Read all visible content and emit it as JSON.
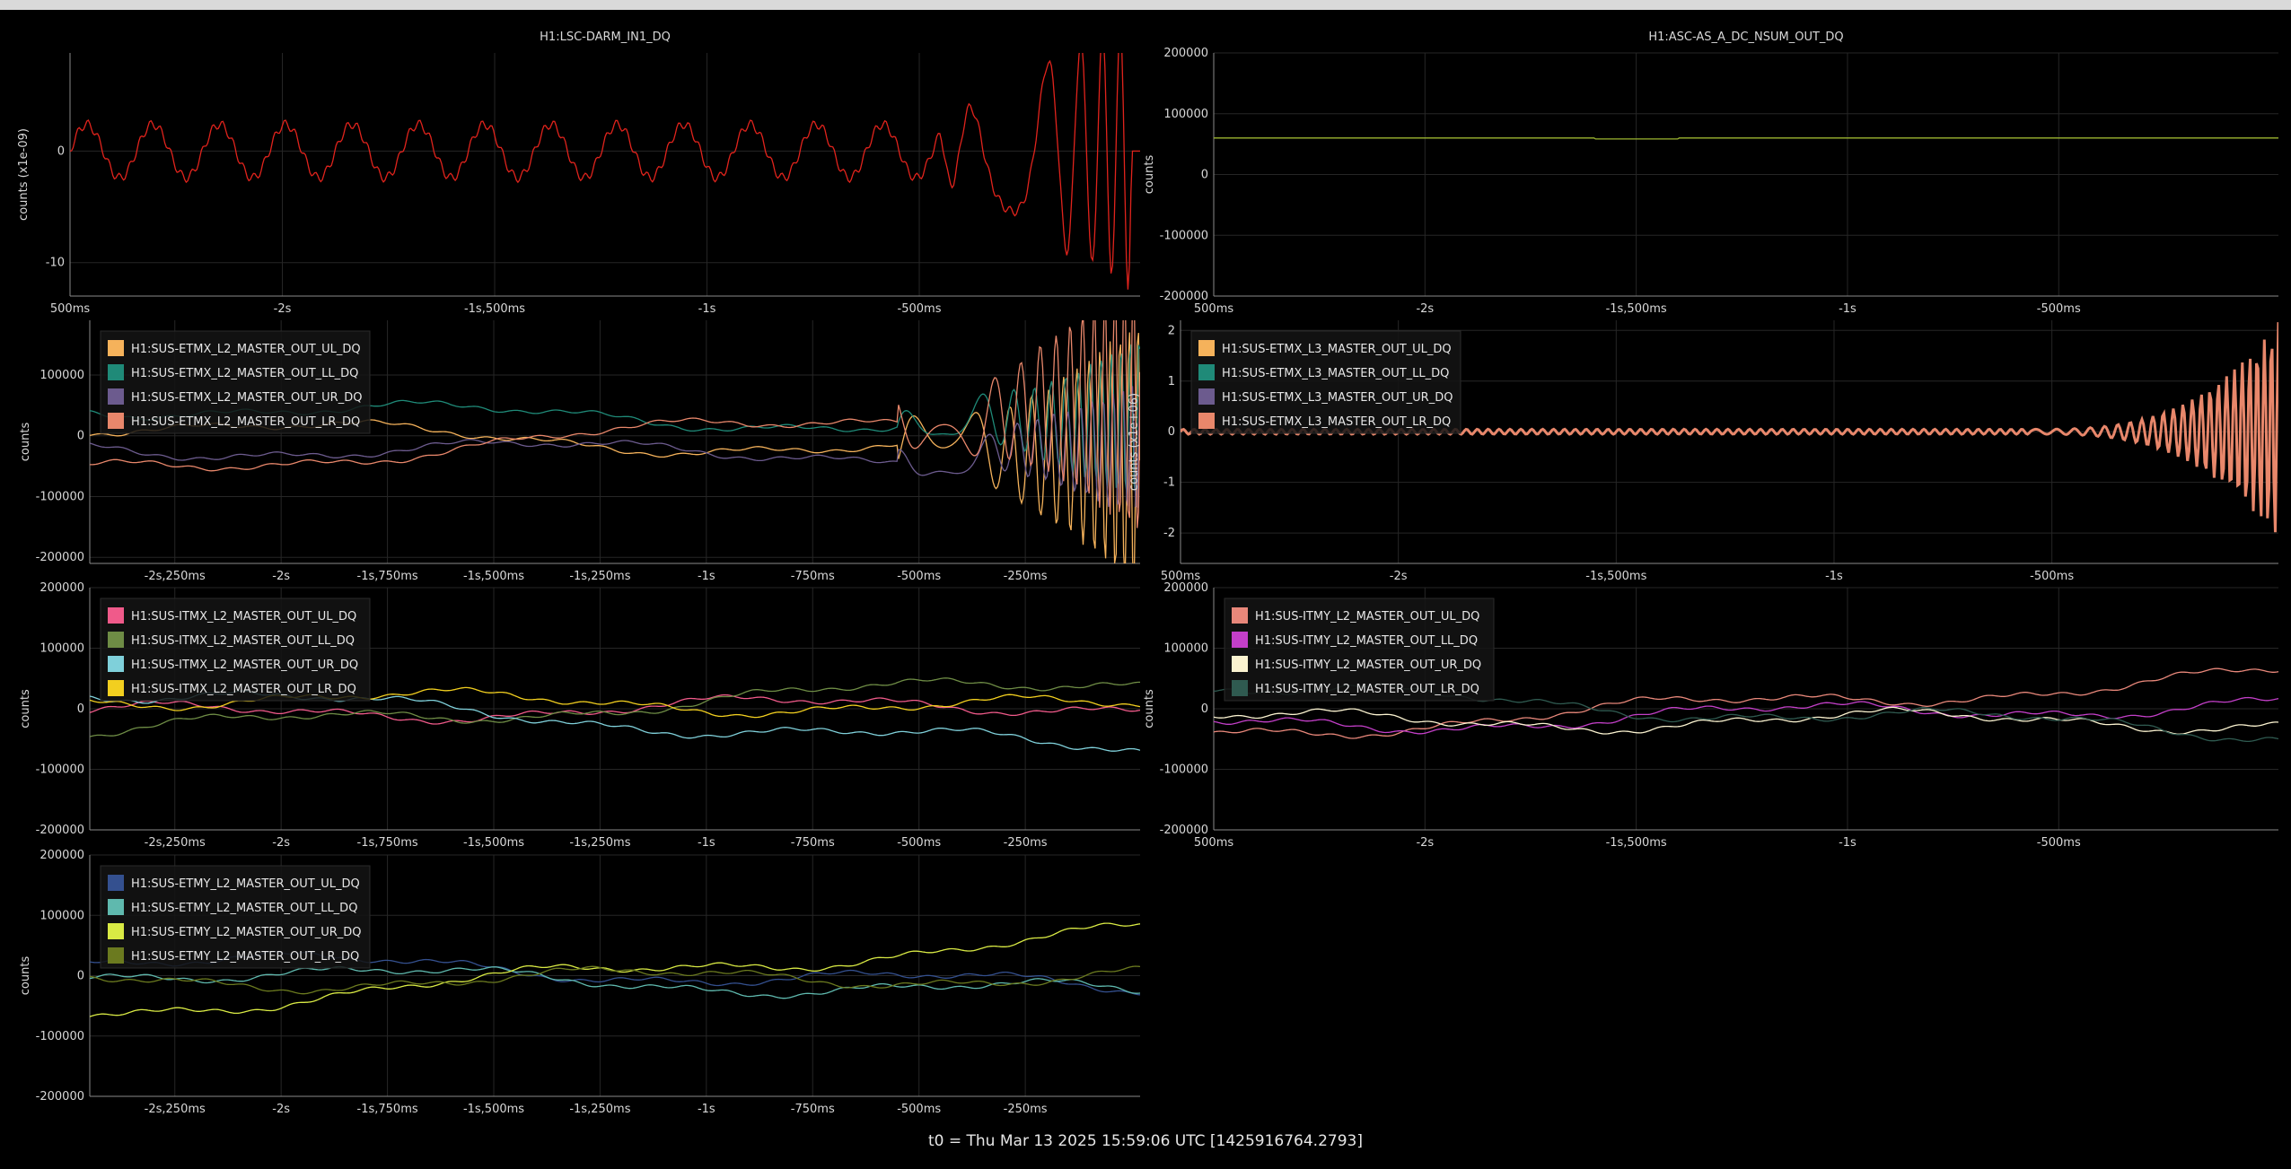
{
  "window": {
    "title_bar": ""
  },
  "footer": {
    "text": "t0 = Thu Mar 13 2025 15:59:06 UTC [1425916764.2793]"
  },
  "colors": {
    "background": "#000000",
    "grid": "#262626",
    "axis": "#8a8a8a",
    "text": "#d8d8d8"
  },
  "chart_data": [
    {
      "id": "darm",
      "type": "line",
      "title": "H1:LSC-DARM_IN1_DQ",
      "ylabel": "counts (x1e-09)",
      "ylim": [
        -13,
        8.8
      ],
      "yticks": [
        {
          "v": 0,
          "label": "0"
        },
        {
          "v": -10,
          "label": "-10"
        }
      ],
      "xlim": [
        -2.5,
        0.02
      ],
      "xticks": [
        {
          "v": -2.5,
          "label": "500ms"
        },
        {
          "v": -2,
          "label": "-2s"
        },
        {
          "v": -1.5,
          "label": "-1s,500ms"
        },
        {
          "v": -1,
          "label": "-1s"
        },
        {
          "v": -0.5,
          "label": "-500ms"
        }
      ],
      "legend": [],
      "series": [
        {
          "name": "",
          "color": "#e0231c",
          "kind": "darm"
        }
      ]
    },
    {
      "id": "asc",
      "type": "line",
      "title": "H1:ASC-AS_A_DC_NSUM_OUT_DQ",
      "ylabel": "counts",
      "ylim": [
        -200000,
        200000
      ],
      "yticks": [
        {
          "v": 200000,
          "label": "200000"
        },
        {
          "v": 100000,
          "label": "100000"
        },
        {
          "v": 0,
          "label": "0"
        },
        {
          "v": -100000,
          "label": "-100000"
        },
        {
          "v": -200000,
          "label": "-200000"
        }
      ],
      "xlim": [
        -2.5,
        0.02
      ],
      "xticks": [
        {
          "v": -2.5,
          "label": "500ms"
        },
        {
          "v": -2,
          "label": "-2s"
        },
        {
          "v": -1.5,
          "label": "-1s,500ms"
        },
        {
          "v": -1,
          "label": "-1s"
        },
        {
          "v": -0.5,
          "label": "-500ms"
        }
      ],
      "legend": [],
      "series": [
        {
          "name": "",
          "color": "#9bb531",
          "kind": "flat",
          "level": 60000
        }
      ]
    },
    {
      "id": "etmx_l2",
      "type": "line",
      "title": "",
      "ylabel": "counts",
      "ylim": [
        -210000,
        190000
      ],
      "yticks": [
        {
          "v": 100000,
          "label": "100000"
        },
        {
          "v": 0,
          "label": "0"
        },
        {
          "v": -100000,
          "label": "-100000"
        },
        {
          "v": -200000,
          "label": "-200000"
        }
      ],
      "xlim": [
        -2.45,
        0.02
      ],
      "xticks": [
        {
          "v": -2.25,
          "label": "-2s,250ms"
        },
        {
          "v": -2,
          "label": "-2s"
        },
        {
          "v": -1.75,
          "label": "-1s,750ms"
        },
        {
          "v": -1.5,
          "label": "-1s,500ms"
        },
        {
          "v": -1.25,
          "label": "-1s,250ms"
        },
        {
          "v": -1,
          "label": "-1s"
        },
        {
          "v": -0.75,
          "label": "-750ms"
        },
        {
          "v": -0.5,
          "label": "-500ms"
        },
        {
          "v": -0.25,
          "label": "-250ms"
        }
      ],
      "legend": [
        "H1:SUS-ETMX_L2_MASTER_OUT_UL_DQ",
        "H1:SUS-ETMX_L2_MASTER_OUT_LL_DQ",
        "H1:SUS-ETMX_L2_MASTER_OUT_UR_DQ",
        "H1:SUS-ETMX_L2_MASTER_OUT_LR_DQ"
      ],
      "series": [
        {
          "name": "H1:SUS-ETMX_L2_MASTER_OUT_UL_DQ",
          "color": "#f5b25b",
          "kind": "wander",
          "a": 20000,
          "b": -40000,
          "seed": 1,
          "burst": 1
        },
        {
          "name": "H1:SUS-ETMX_L2_MASTER_OUT_LL_DQ",
          "color": "#1f8a78",
          "kind": "wander",
          "a": 50000,
          "b": 10000,
          "seed": 2,
          "burst": 0.6
        },
        {
          "name": "H1:SUS-ETMX_L2_MASTER_OUT_UR_DQ",
          "color": "#6c5b8e",
          "kind": "wander",
          "a": -20000,
          "b": -30000,
          "seed": 3,
          "burst": 0.5
        },
        {
          "name": "H1:SUS-ETMX_L2_MASTER_OUT_LR_DQ",
          "color": "#e8876b",
          "kind": "wander",
          "a": -60000,
          "b": 60000,
          "seed": 4,
          "burst": 1
        }
      ]
    },
    {
      "id": "etmx_l3",
      "type": "line",
      "title": "",
      "ylabel": "counts (x1e+06)",
      "ylim": [
        -2.6,
        2.2
      ],
      "yticks": [
        {
          "v": 2,
          "label": "2"
        },
        {
          "v": 1,
          "label": "1"
        },
        {
          "v": 0,
          "label": "0"
        },
        {
          "v": -1,
          "label": "-1"
        },
        {
          "v": -2,
          "label": "-2"
        }
      ],
      "xlim": [
        -2.5,
        0.02
      ],
      "xticks": [
        {
          "v": -2.5,
          "label": "500ms"
        },
        {
          "v": -2,
          "label": "-2s"
        },
        {
          "v": -1.5,
          "label": "-1s,500ms"
        },
        {
          "v": -1,
          "label": "-1s"
        },
        {
          "v": -0.5,
          "label": "-500ms"
        }
      ],
      "legend": [
        "H1:SUS-ETMX_L3_MASTER_OUT_UL_DQ",
        "H1:SUS-ETMX_L3_MASTER_OUT_LL_DQ",
        "H1:SUS-ETMX_L3_MASTER_OUT_UR_DQ",
        "H1:SUS-ETMX_L3_MASTER_OUT_LR_DQ"
      ],
      "series": [
        {
          "name": "H1:SUS-ETMX_L3_MASTER_OUT_LR_DQ",
          "color": "#e8876b",
          "kind": "l3"
        }
      ]
    },
    {
      "id": "itmx_l2",
      "type": "line",
      "title": "",
      "ylabel": "counts",
      "ylim": [
        -200000,
        200000
      ],
      "yticks": [
        {
          "v": 200000,
          "label": "200000"
        },
        {
          "v": 100000,
          "label": "100000"
        },
        {
          "v": 0,
          "label": "0"
        },
        {
          "v": -100000,
          "label": "-100000"
        },
        {
          "v": -200000,
          "label": "-200000"
        }
      ],
      "xlim": [
        -2.45,
        0.02
      ],
      "xticks": [
        {
          "v": -2.25,
          "label": "-2s,250ms"
        },
        {
          "v": -2,
          "label": "-2s"
        },
        {
          "v": -1.75,
          "label": "-1s,750ms"
        },
        {
          "v": -1.5,
          "label": "-1s,500ms"
        },
        {
          "v": -1.25,
          "label": "-1s,250ms"
        },
        {
          "v": -1,
          "label": "-1s"
        },
        {
          "v": -0.75,
          "label": "-750ms"
        },
        {
          "v": -0.5,
          "label": "-500ms"
        },
        {
          "v": -0.25,
          "label": "-250ms"
        }
      ],
      "legend": [
        "H1:SUS-ITMX_L2_MASTER_OUT_UL_DQ",
        "H1:SUS-ITMX_L2_MASTER_OUT_LL_DQ",
        "H1:SUS-ITMX_L2_MASTER_OUT_UR_DQ",
        "H1:SUS-ITMX_L2_MASTER_OUT_LR_DQ"
      ],
      "series": [
        {
          "name": "H1:SUS-ITMX_L2_MASTER_OUT_UL_DQ",
          "color": "#f05a8a",
          "kind": "wander",
          "a": -10000,
          "b": 10000,
          "seed": 5,
          "burst": 0
        },
        {
          "name": "H1:SUS-ITMX_L2_MASTER_OUT_LL_DQ",
          "color": "#6e8c45",
          "kind": "wander",
          "a": -40000,
          "b": 50000,
          "seed": 6,
          "burst": 0
        },
        {
          "name": "H1:SUS-ITMX_L2_MASTER_OUT_UR_DQ",
          "color": "#7fd0da",
          "kind": "wander",
          "a": 30000,
          "b": -70000,
          "seed": 7,
          "burst": 0
        },
        {
          "name": "H1:SUS-ITMX_L2_MASTER_OUT_LR_DQ",
          "color": "#f2cf1f",
          "kind": "wander",
          "a": 20000,
          "b": 0,
          "seed": 8,
          "burst": 0
        }
      ]
    },
    {
      "id": "itmy_l2",
      "type": "line",
      "title": "",
      "ylabel": "counts",
      "ylim": [
        -200000,
        200000
      ],
      "yticks": [
        {
          "v": 200000,
          "label": "200000"
        },
        {
          "v": 100000,
          "label": "100000"
        },
        {
          "v": 0,
          "label": "0"
        },
        {
          "v": -100000,
          "label": "-100000"
        },
        {
          "v": -200000,
          "label": "-200000"
        }
      ],
      "xlim": [
        -2.5,
        0.02
      ],
      "xticks": [
        {
          "v": -2.5,
          "label": "500ms"
        },
        {
          "v": -2,
          "label": "-2s"
        },
        {
          "v": -1.5,
          "label": "-1s,500ms"
        },
        {
          "v": -1,
          "label": "-1s"
        },
        {
          "v": -0.5,
          "label": "-500ms"
        }
      ],
      "legend": [
        "H1:SUS-ITMY_L2_MASTER_OUT_UL_DQ",
        "H1:SUS-ITMY_L2_MASTER_OUT_LL_DQ",
        "H1:SUS-ITMY_L2_MASTER_OUT_UR_DQ",
        "H1:SUS-ITMY_L2_MASTER_OUT_LR_DQ"
      ],
      "series": [
        {
          "name": "H1:SUS-ITMY_L2_MASTER_OUT_UL_DQ",
          "color": "#e8877a",
          "kind": "wander",
          "a": -40000,
          "b": 55000,
          "seed": 9,
          "burst": 0
        },
        {
          "name": "H1:SUS-ITMY_L2_MASTER_OUT_LL_DQ",
          "color": "#c33fc8",
          "kind": "wander",
          "a": -30000,
          "b": 10000,
          "seed": 10,
          "burst": 0
        },
        {
          "name": "H1:SUS-ITMY_L2_MASTER_OUT_UR_DQ",
          "color": "#fbf3d0",
          "kind": "wander",
          "a": -20000,
          "b": -20000,
          "seed": 11,
          "burst": 0
        },
        {
          "name": "H1:SUS-ITMY_L2_MASTER_OUT_LR_DQ",
          "color": "#2f5a50",
          "kind": "wander",
          "a": 30000,
          "b": -40000,
          "seed": 12,
          "burst": 0
        }
      ]
    },
    {
      "id": "etmy_l2",
      "type": "line",
      "title": "",
      "ylabel": "counts",
      "ylim": [
        -200000,
        200000
      ],
      "yticks": [
        {
          "v": 200000,
          "label": "200000"
        },
        {
          "v": 100000,
          "label": "100000"
        },
        {
          "v": 0,
          "label": "0"
        },
        {
          "v": -100000,
          "label": "-100000"
        },
        {
          "v": -200000,
          "label": "-200000"
        }
      ],
      "xlim": [
        -2.45,
        0.02
      ],
      "xticks": [
        {
          "v": -2.25,
          "label": "-2s,250ms"
        },
        {
          "v": -2,
          "label": "-2s"
        },
        {
          "v": -1.75,
          "label": "-1s,750ms"
        },
        {
          "v": -1.5,
          "label": "-1s,500ms"
        },
        {
          "v": -1.25,
          "label": "-1s,250ms"
        },
        {
          "v": -1,
          "label": "-1s"
        },
        {
          "v": -0.75,
          "label": "-750ms"
        },
        {
          "v": -0.5,
          "label": "-500ms"
        },
        {
          "v": -0.25,
          "label": "-250ms"
        }
      ],
      "legend": [
        "H1:SUS-ETMY_L2_MASTER_OUT_UL_DQ",
        "H1:SUS-ETMY_L2_MASTER_OUT_LL_DQ",
        "H1:SUS-ETMY_L2_MASTER_OUT_UR_DQ",
        "H1:SUS-ETMY_L2_MASTER_OUT_LR_DQ"
      ],
      "series": [
        {
          "name": "H1:SUS-ETMY_L2_MASTER_OUT_UL_DQ",
          "color": "#34508f",
          "kind": "wander",
          "a": 30000,
          "b": -20000,
          "seed": 13,
          "burst": 0
        },
        {
          "name": "H1:SUS-ETMY_L2_MASTER_OUT_LL_DQ",
          "color": "#5fb9ae",
          "kind": "wander",
          "a": 10000,
          "b": -30000,
          "seed": 14,
          "burst": 0
        },
        {
          "name": "H1:SUS-ETMY_L2_MASTER_OUT_UR_DQ",
          "color": "#d9ea44",
          "kind": "wander",
          "a": -60000,
          "b": 70000,
          "seed": 15,
          "burst": 0
        },
        {
          "name": "H1:SUS-ETMY_L2_MASTER_OUT_LR_DQ",
          "color": "#6b7a1f",
          "kind": "wander",
          "a": -10000,
          "b": 0,
          "seed": 16,
          "burst": 0
        }
      ]
    }
  ]
}
